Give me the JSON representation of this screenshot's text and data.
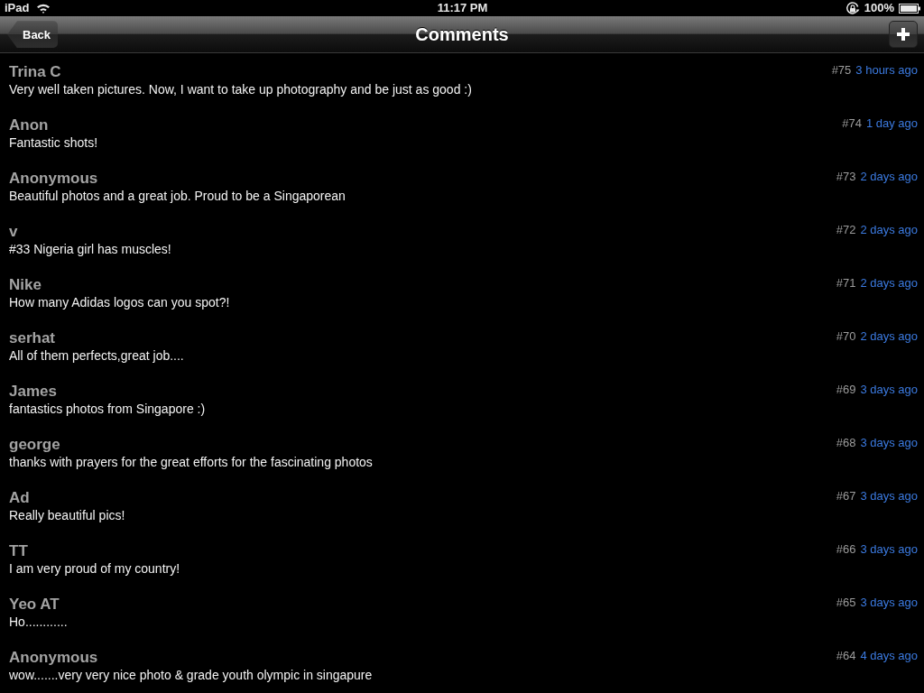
{
  "status_bar": {
    "device": "iPad",
    "time": "11:17 PM",
    "battery": "100%"
  },
  "nav_bar": {
    "back_button": "Back",
    "title": "Comments"
  },
  "comments": [
    {
      "author": "Trina C",
      "text": "Very well taken pictures. Now, I want to take up photography and be just as good :)",
      "number": "#75",
      "time": "3 hours ago"
    },
    {
      "author": "Anon",
      "text": "Fantastic shots!",
      "number": "#74",
      "time": "1 day ago"
    },
    {
      "author": "Anonymous",
      "text": "Beautiful photos and a great job. Proud to be a Singaporean",
      "number": "#73",
      "time": "2 days ago"
    },
    {
      "author": "v",
      "text": "#33 Nigeria girl has muscles!",
      "number": "#72",
      "time": "2 days ago"
    },
    {
      "author": "Nike",
      "text": "How many Adidas logos can you spot?!",
      "number": "#71",
      "time": "2 days ago"
    },
    {
      "author": "serhat",
      "text": "All of them perfects,great job....",
      "number": "#70",
      "time": "2 days ago"
    },
    {
      "author": "James",
      "text": "fantastics photos from Singapore :)",
      "number": "#69",
      "time": "3 days ago"
    },
    {
      "author": "george",
      "text": "thanks with prayers for the great efforts for the fascinating photos",
      "number": "#68",
      "time": "3 days ago"
    },
    {
      "author": "Ad",
      "text": "Really beautiful pics!",
      "number": "#67",
      "time": "3 days ago"
    },
    {
      "author": "TT",
      "text": "I am very proud of my country!",
      "number": "#66",
      "time": "3 days ago"
    },
    {
      "author": "Yeo AT",
      "text": "Ho............",
      "number": "#65",
      "time": "3 days ago"
    },
    {
      "author": "Anonymous",
      "text": "wow.......very very nice photo & grade youth olympic in singapure",
      "number": "#64",
      "time": "4 days ago"
    }
  ]
}
